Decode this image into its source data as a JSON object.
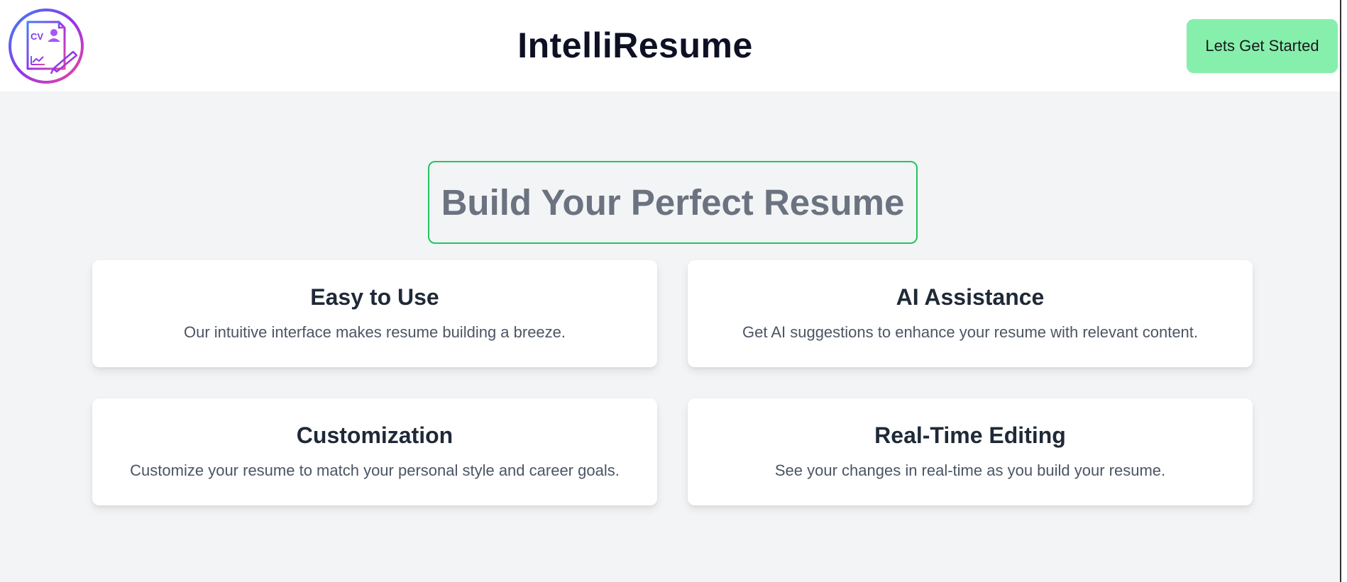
{
  "header": {
    "app_title": "IntelliResume",
    "cta_label": "Lets Get Started",
    "logo": {
      "icon": "cv-document-icon",
      "text": "CV",
      "gradient": [
        "#3b82f6",
        "#9333ea",
        "#ec4899"
      ]
    }
  },
  "hero": {
    "title": "Build Your Perfect Resume"
  },
  "features": [
    {
      "title": "Easy to Use",
      "description": "Our intuitive interface makes resume building a breeze."
    },
    {
      "title": "AI Assistance",
      "description": "Get AI suggestions to enhance your resume with relevant content."
    },
    {
      "title": "Customization",
      "description": "Customize your resume to match your personal style and career goals."
    },
    {
      "title": "Real-Time Editing",
      "description": "See your changes in real-time as you build your resume."
    }
  ],
  "colors": {
    "cta_background": "#86efac",
    "hero_border": "#22c55e",
    "page_background": "#f2f4f6"
  }
}
